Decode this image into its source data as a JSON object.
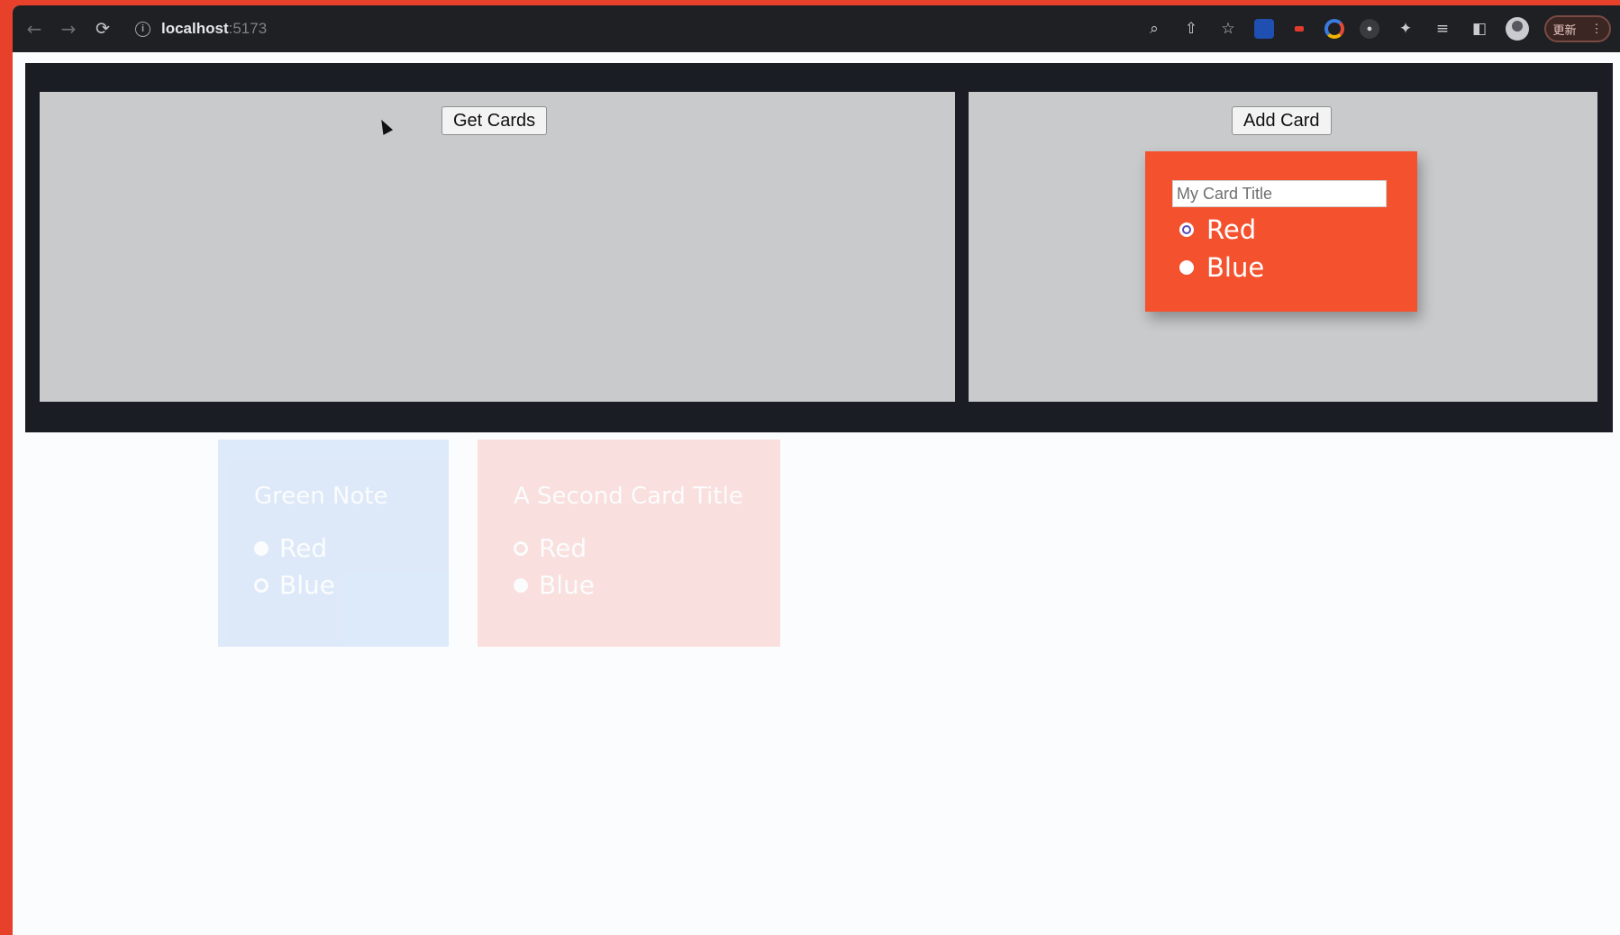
{
  "browser": {
    "url_host": "localhost",
    "url_port": ":5173",
    "update_label": "更新",
    "update_menu": "⋮"
  },
  "app": {
    "get_cards_label": "Get Cards",
    "add_card_label": "Add Card",
    "form": {
      "title_placeholder": "My Card Title",
      "options": [
        "Red",
        "Blue"
      ],
      "selected": "Blue",
      "accent_color": "#f4522f"
    },
    "background_cards": [
      {
        "title": "Green Note",
        "color": "#2c7de0",
        "options": [
          "Red",
          "Blue"
        ],
        "selected": "Red"
      },
      {
        "title": "A Second Card Title",
        "color": "#ee3a25",
        "options": [
          "Red",
          "Blue"
        ],
        "selected": "Blue"
      }
    ]
  }
}
